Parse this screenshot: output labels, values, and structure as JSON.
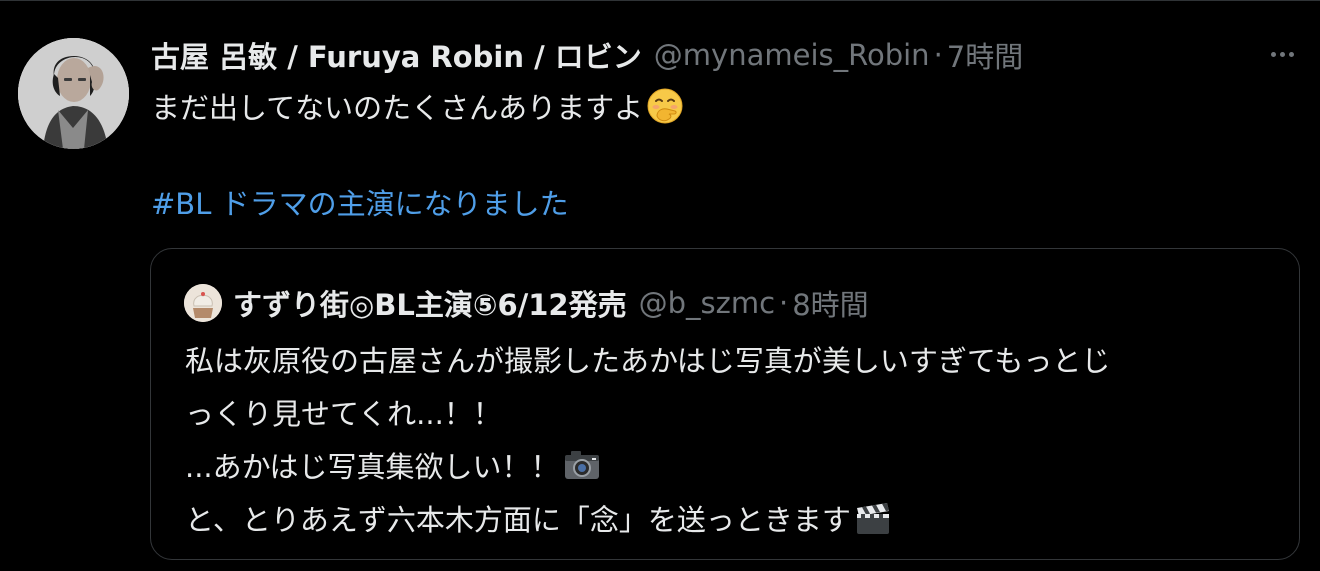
{
  "tweet": {
    "display_name": "古屋 呂敏 / Furuya Robin / ロビン",
    "handle": "@mynameis_Robin",
    "separator": "·",
    "time": "7時間",
    "text": "まだ出してないのたくさんありますよ",
    "text_emoji": "face-with-hand-over-mouth",
    "hashtag": "#BL ドラマの主演になりました"
  },
  "quote": {
    "display_name": "すずり街◎BL主演⑤6/12発売",
    "handle": "@b_szmc",
    "separator": "·",
    "time": "8時間",
    "lines": [
      "私は灰原役の古屋さんが撮影したあかはじ写真が美しいすぎてもっとじ",
      "っくり見せてくれ...！！",
      "...あかはじ写真集欲しい！！",
      "と、とりあえず六本木方面に「念」を送っときます"
    ],
    "line3_emoji": "camera",
    "line4_emoji": "clapper-board"
  },
  "colors": {
    "background": "#000000",
    "text_primary": "#e7e9ea",
    "text_secondary": "#71767b",
    "link": "#4f9ee8",
    "border": "#333639"
  }
}
